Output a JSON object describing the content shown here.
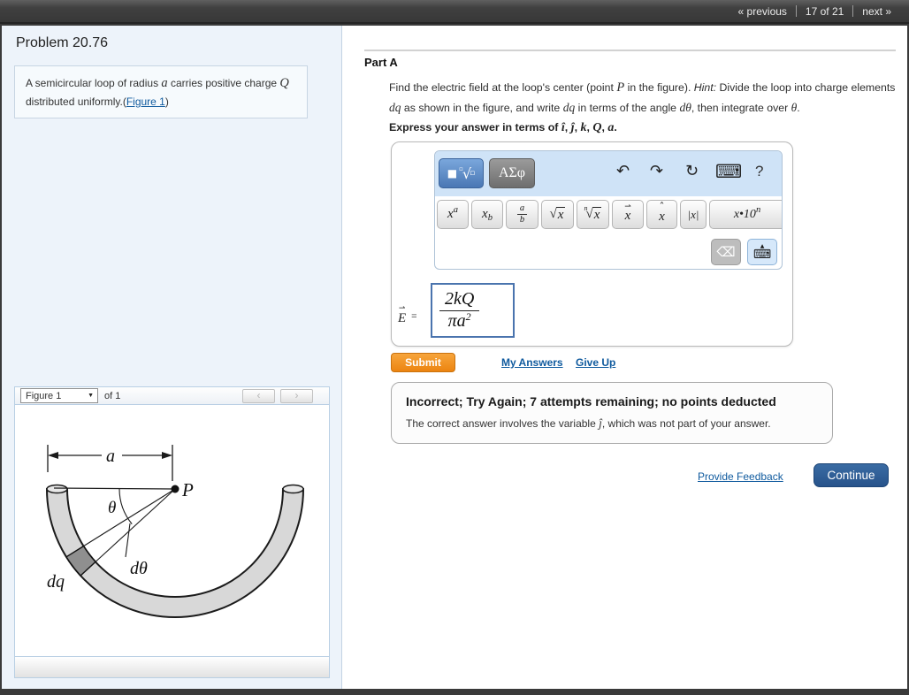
{
  "topbar": {
    "previous": "« previous",
    "counter": "17 of 21",
    "next": "next »"
  },
  "left": {
    "title": "Problem 20.76",
    "statement": {
      "s1": "A semicircular loop of radius ",
      "v1": "a",
      "s2": " carries positive charge ",
      "v2": "Q",
      "s3": " distributed uniformly.(",
      "link": "Figure 1",
      "s4": ")"
    },
    "figure": {
      "selector": "Figure 1",
      "selector_arrow": "▼",
      "of": "of 1",
      "prev": "‹",
      "next": "›",
      "labels": {
        "a": "a",
        "P": "P",
        "theta": "θ",
        "d_theta": "dθ",
        "dq": "dq"
      }
    }
  },
  "main": {
    "part_title": "Part A",
    "question": {
      "s1": "Find the electric field at the loop's center (point ",
      "v1": "P",
      "s2": " in the figure). ",
      "hint": "Hint:",
      "s3": " Divide the loop into charge elements ",
      "v2": "dq",
      "s4": " as shown in the figure, and write ",
      "v3": "dq",
      "s5": " in terms of the angle ",
      "v4": "dθ",
      "s6": ", then integrate over ",
      "v5": "θ",
      "s7": "."
    },
    "express": {
      "s1": "Express your answer in terms of ",
      "v1": "î",
      "c1": ", ",
      "v2": "ĵ",
      "c2": ", ",
      "v3": "k",
      "c3": ", ",
      "v4": "Q",
      "c4": ", ",
      "v5": "a",
      "end": "."
    },
    "editor": {
      "tpl_icon": {
        "sq": "■",
        "idx": "▫",
        "root": "√",
        "box": "▫"
      },
      "greek": "ΑΣφ",
      "icons": {
        "undo": "↶",
        "redo": "↷",
        "reset": "↻",
        "keyboard": "⌨",
        "help": "?",
        "backspace": "⌫",
        "kb_arrow": "▲",
        "kb": "⌨"
      },
      "buttons": {
        "sup": {
          "base": "x",
          "sup": "a"
        },
        "sub": {
          "base": "x",
          "sub": "b"
        },
        "frac": {
          "num": "a",
          "den": "b"
        },
        "sqrt": {
          "sign": "√",
          "rad": "x"
        },
        "nroot": {
          "idx": "n",
          "sign": "√",
          "rad": "x"
        },
        "vec": {
          "base": "x",
          "accent": "⇀"
        },
        "hat": {
          "base": "x",
          "accent": "ˆ"
        },
        "abs": {
          "label": "|x|"
        },
        "e10": {
          "base": "x•10",
          "sup": "n"
        }
      }
    },
    "answer": {
      "lhs": "E",
      "lhs_arrow": "⇀",
      "equals": "=",
      "num": "2kQ",
      "den_base": "πa",
      "den_sup": "2"
    },
    "submit": "Submit",
    "my_answers": "My Answers",
    "give_up": "Give Up",
    "feedback": {
      "title": "Incorrect; Try Again; 7 attempts remaining; no points deducted",
      "s1": "The correct answer involves the variable ",
      "v1": "ĵ",
      "s2": ", which was not part of your answer."
    },
    "provide_feedback": "Provide Feedback",
    "continue": "Continue"
  },
  "colors": {
    "topbar": "#3f3f3f",
    "panel_blue": "#edf3fa",
    "link_blue": "#0f5a9e",
    "submit_orange": "#ec8410",
    "continue_blue": "#27538b",
    "toolbar_blue": "#cfe3f7",
    "input_border": "#4a74ae"
  }
}
